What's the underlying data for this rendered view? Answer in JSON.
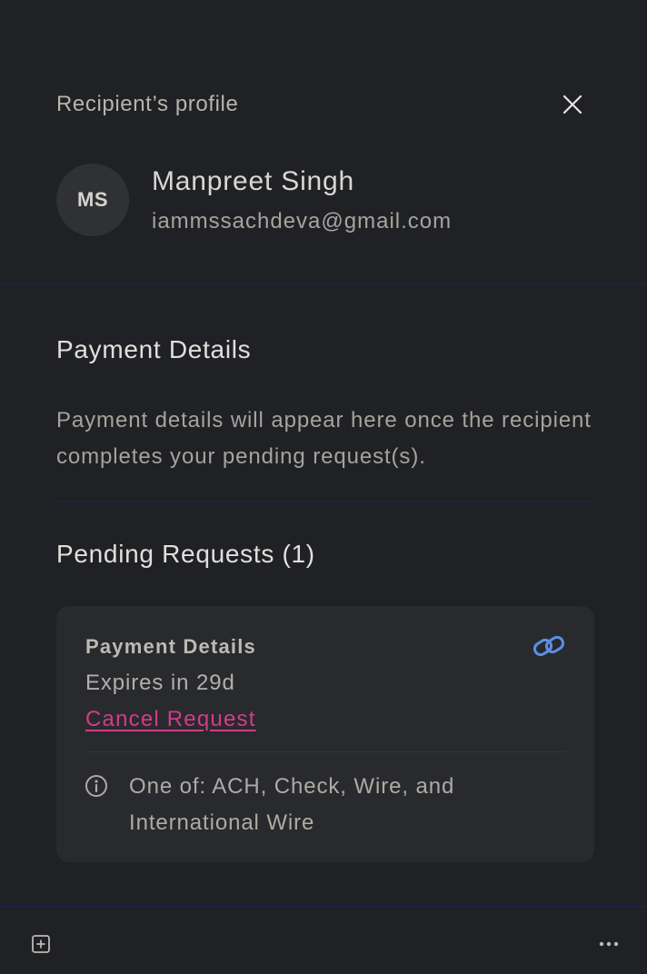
{
  "header": {
    "title": "Recipient’s profile",
    "close_icon": "close-icon"
  },
  "recipient": {
    "initials": "MS",
    "name": "Manpreet Singh",
    "email": "iammssachdeva@gmail.com"
  },
  "payment_details": {
    "heading": "Payment Details",
    "description": "Payment details will appear here once the recipient completes your pending request(s)."
  },
  "pending": {
    "heading": "Pending Requests (1)",
    "requests": [
      {
        "title": "Payment Details",
        "expiry": "Expires in 29d",
        "cancel_label": "Cancel Request",
        "link_icon": "link-icon",
        "info_icon": "info-icon",
        "note": "One of: ACH, Check, Wire, and International Wire"
      }
    ]
  },
  "footer": {
    "add_icon": "add-square-icon",
    "more_icon": "more-horizontal-icon"
  },
  "colors": {
    "background": "#202124",
    "card": "#292a2d",
    "accent_link": "#d03c8c",
    "link_icon": "#5b8fe8",
    "divider": "#1f2146"
  }
}
